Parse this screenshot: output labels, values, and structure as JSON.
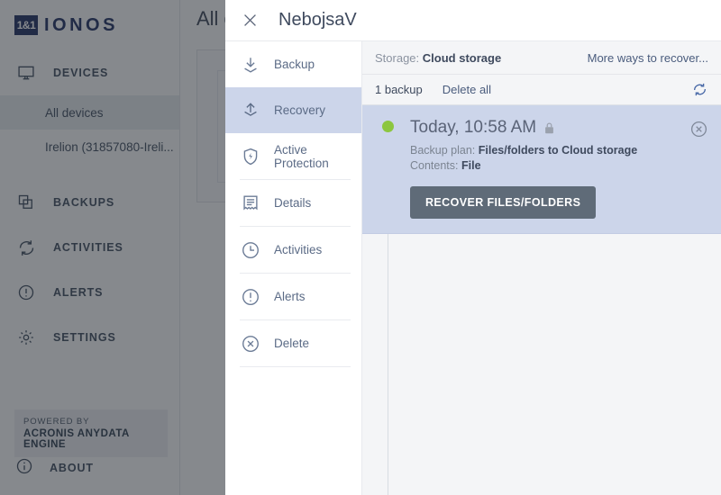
{
  "background": {
    "brand": {
      "mark": "1&1",
      "name": "IONOS"
    },
    "nav": [
      {
        "label": "DEVICES",
        "icon": "monitor-icon"
      },
      {
        "label": "BACKUPS",
        "icon": "copies-icon"
      },
      {
        "label": "ACTIVITIES",
        "icon": "sync-icon"
      },
      {
        "label": "ALERTS",
        "icon": "alert-circle-icon"
      },
      {
        "label": "SETTINGS",
        "icon": "gear-icon"
      }
    ],
    "devices": [
      {
        "label": "All devices",
        "active": true
      },
      {
        "label": "Irelion (31857080-Ireli...",
        "active": false
      }
    ],
    "powered_by": {
      "line1": "POWERED BY",
      "line2": "ACRONIS ANYDATA ENGINE"
    },
    "about": {
      "label": "ABOUT",
      "icon": "info-circle-icon"
    },
    "page_title": "All devices"
  },
  "panel": {
    "title": "NebojsaV",
    "close_icon": "close-icon",
    "menu": [
      {
        "label": "Backup",
        "icon": "download-arrow-icon",
        "selected": false,
        "divider_above": false
      },
      {
        "label": "Recovery",
        "icon": "upload-arrow-icon",
        "selected": true,
        "divider_above": false
      },
      {
        "label": "Active Protection",
        "icon": "shield-bolt-icon",
        "selected": false,
        "divider_above": false
      },
      {
        "label": "Details",
        "icon": "document-icon",
        "selected": false,
        "divider_above": true
      },
      {
        "label": "Activities",
        "icon": "clock-icon",
        "selected": false,
        "divider_above": true
      },
      {
        "label": "Alerts",
        "icon": "alert-circle-icon",
        "selected": false,
        "divider_above": true
      },
      {
        "label": "Delete",
        "icon": "close-circle-icon",
        "selected": false,
        "divider_above": true
      }
    ],
    "storage": {
      "label": "Storage:",
      "value": "Cloud storage",
      "more_ways": "More ways to recover..."
    },
    "toolbar": {
      "count": "1 backup",
      "delete_all": "Delete all",
      "refresh_icon": "refresh-icon"
    },
    "backups": [
      {
        "time": "Today, 10:58 AM",
        "encrypted_icon": "lock-icon",
        "status_color": "#8cc63f",
        "plan_label": "Backup plan:",
        "plan_value": "Files/folders to Cloud storage",
        "contents_label": "Contents:",
        "contents_value": "File",
        "action_label": "RECOVER FILES/FOLDERS",
        "remove_icon": "close-circle-icon"
      }
    ]
  },
  "colors": {
    "brand_navy": "#1b2a5e",
    "selected_blue": "#ccd5ea",
    "status_green": "#8cc63f",
    "button_slate": "#5f6b78"
  }
}
